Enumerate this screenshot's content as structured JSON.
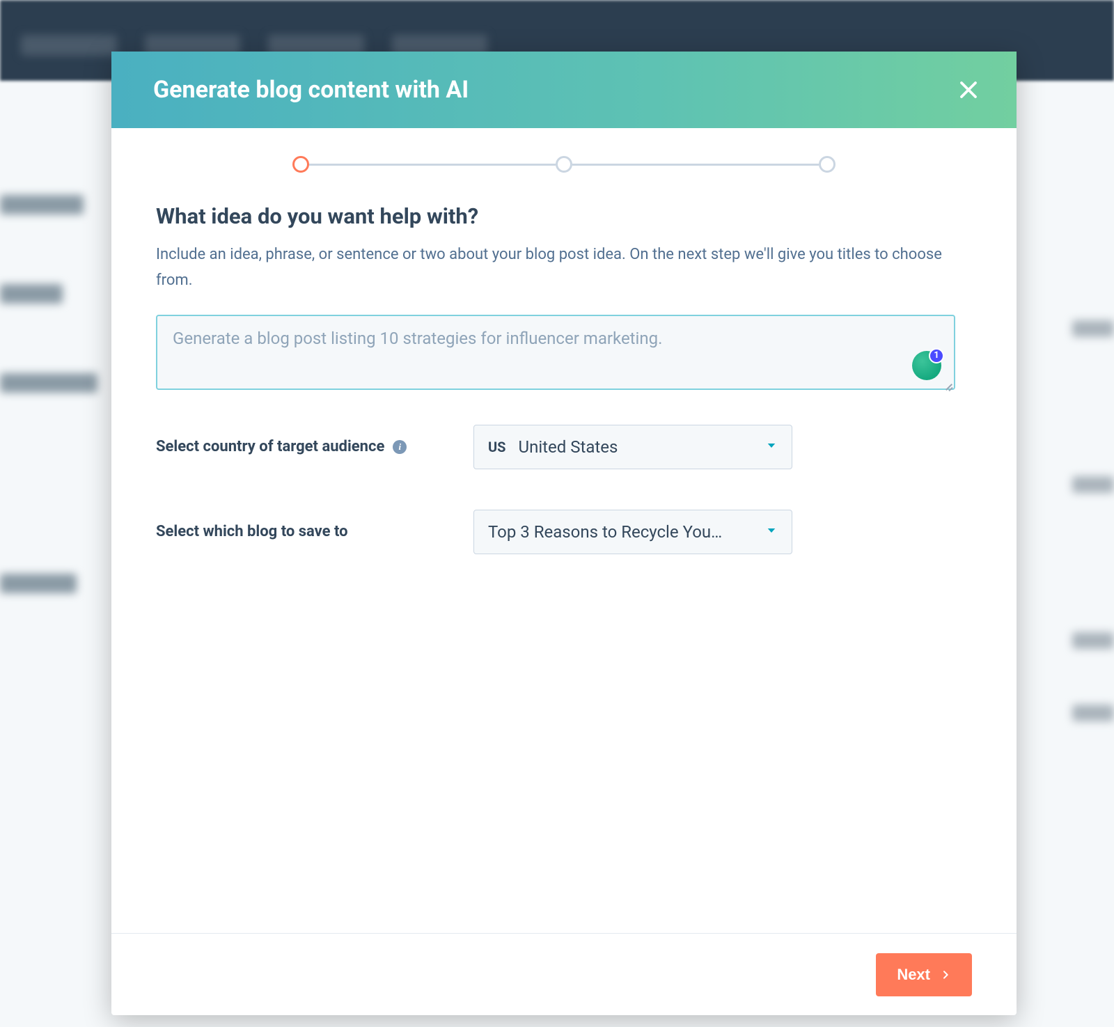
{
  "modal": {
    "title": "Generate blog content with AI",
    "question": "What idea do you want help with?",
    "hint": "Include an idea, phrase, or sentence or two about your blog post idea. On the next step we'll give you titles to choose from.",
    "idea_placeholder": "Generate a blog post listing 10 strategies for influencer marketing.",
    "idea_value": "",
    "country_label": "Select country of target audience",
    "country_code": "US",
    "country_value": "United States",
    "blog_label": "Select which blog to save to",
    "blog_value": "Top 3 Reasons to Recycle You…",
    "next_label": "Next",
    "grammarly_count": "1"
  },
  "stepper": {
    "current": 1,
    "total": 3
  }
}
